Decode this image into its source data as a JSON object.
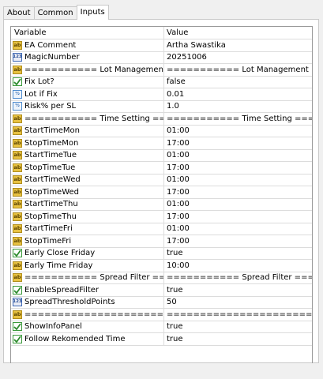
{
  "tabs": [
    "About",
    "Common",
    "Inputs"
  ],
  "active_tab": "Inputs",
  "table": {
    "headers": {
      "variable": "Variable",
      "value": "Value"
    },
    "rows": [
      {
        "icon": "ab",
        "variable": "EA Comment",
        "value": "Artha Swastika"
      },
      {
        "icon": "123",
        "variable": "MagicNumber",
        "value": "20251006"
      },
      {
        "icon": "ab",
        "variable": "=========== Lot Management ===========",
        "value": "=========== Lot Management ==========="
      },
      {
        "icon": "bool",
        "variable": "Fix Lot?",
        "value": "false"
      },
      {
        "icon": "half",
        "variable": "Lot if Fix",
        "value": "0.01"
      },
      {
        "icon": "half",
        "variable": "Risk% per SL",
        "value": "1.0"
      },
      {
        "icon": "ab",
        "variable": "=========== Time Setting ==========",
        "value": "=========== Time Setting =========="
      },
      {
        "icon": "ab",
        "variable": "StartTimeMon",
        "value": "01:00"
      },
      {
        "icon": "ab",
        "variable": "StopTimeMon",
        "value": "17:00"
      },
      {
        "icon": "ab",
        "variable": "StartTimeTue",
        "value": "01:00"
      },
      {
        "icon": "ab",
        "variable": "StopTimeTue",
        "value": "17:00"
      },
      {
        "icon": "ab",
        "variable": "StartTimeWed",
        "value": "01:00"
      },
      {
        "icon": "ab",
        "variable": "StopTimeWed",
        "value": "17:00"
      },
      {
        "icon": "ab",
        "variable": "StartTimeThu",
        "value": "01:00"
      },
      {
        "icon": "ab",
        "variable": "StopTimeThu",
        "value": "17:00"
      },
      {
        "icon": "ab",
        "variable": "StartTimeFri",
        "value": "01:00"
      },
      {
        "icon": "ab",
        "variable": "StopTimeFri",
        "value": "17:00"
      },
      {
        "icon": "bool",
        "variable": "Early Close Friday",
        "value": "true"
      },
      {
        "icon": "ab",
        "variable": "Early Time Friday",
        "value": "10:00"
      },
      {
        "icon": "ab",
        "variable": "=========== Spread Filter ==========",
        "value": "=========== Spread Filter =========="
      },
      {
        "icon": "bool",
        "variable": "EnableSpreadFilter",
        "value": "true"
      },
      {
        "icon": "123",
        "variable": "SpreadThresholdPoints",
        "value": "50"
      },
      {
        "icon": "ab",
        "variable": "==============================",
        "value": "=============================="
      },
      {
        "icon": "bool",
        "variable": "ShowInfoPanel",
        "value": "true"
      },
      {
        "icon": "bool",
        "variable": "Follow Rekomended Time",
        "value": "true"
      }
    ]
  },
  "colors": {
    "string_icon": "#e8c242",
    "int_icon": "#3f69b5",
    "double_icon": "#4e8ccf",
    "bool_icon": "#3a9a3a"
  }
}
